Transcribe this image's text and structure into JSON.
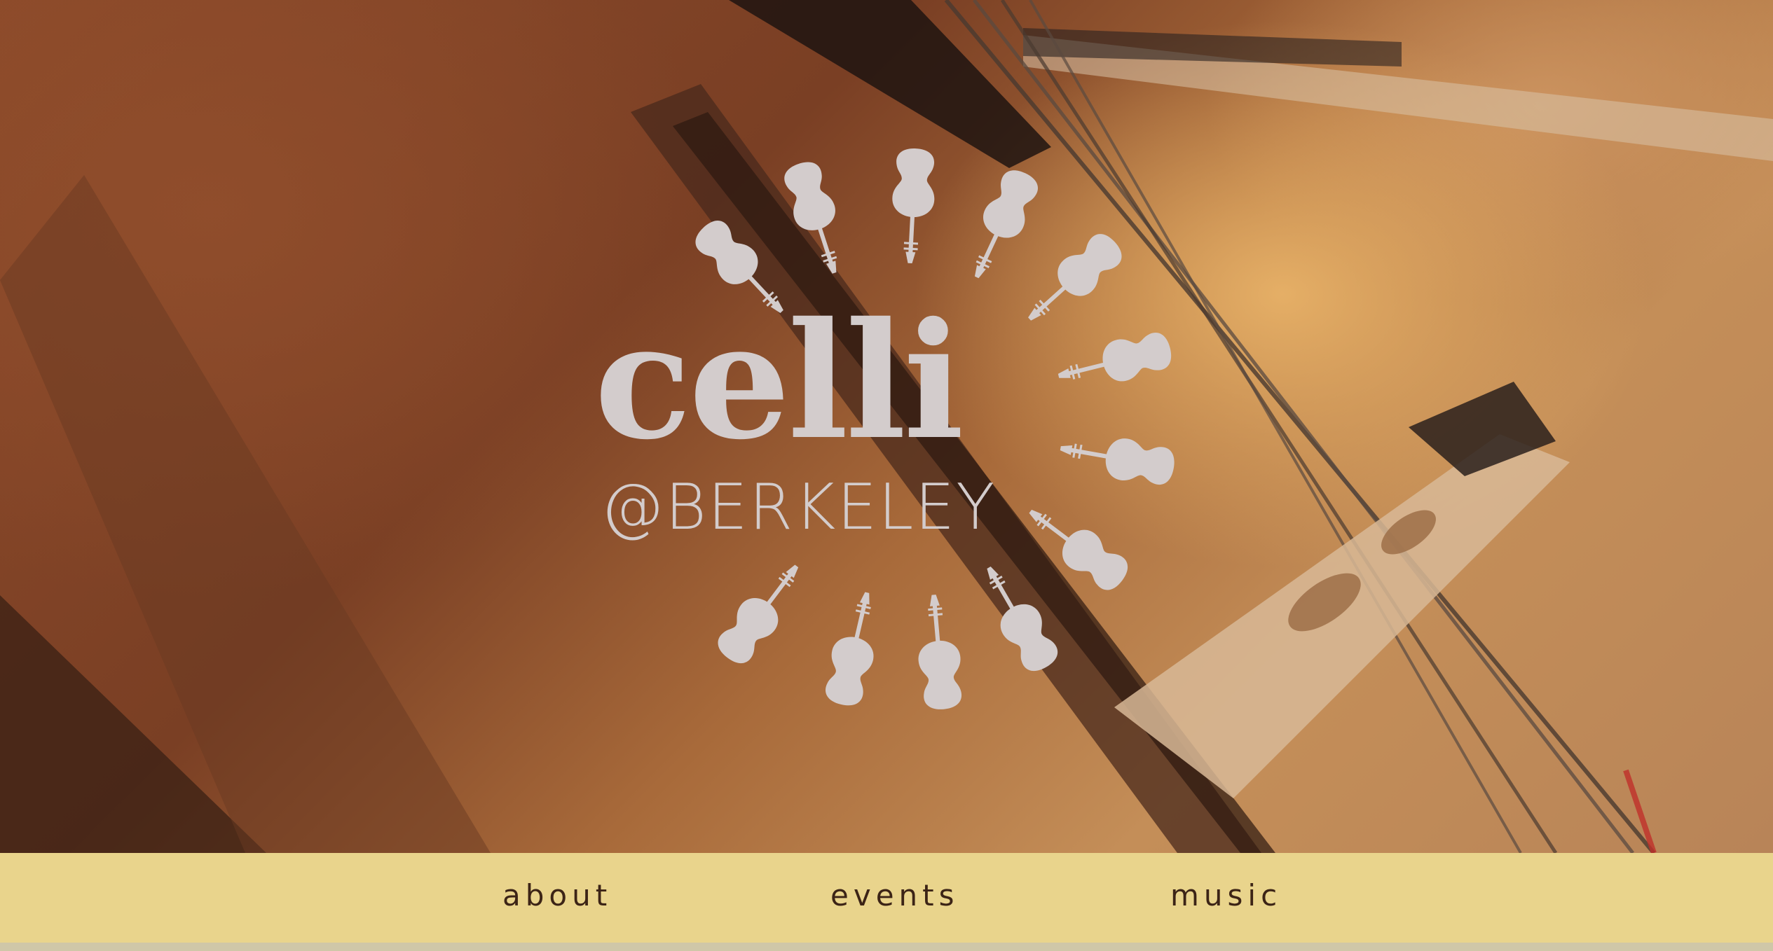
{
  "logo": {
    "title": "celli",
    "subtitle": "@BERKELEY",
    "icon": "cello-ring-icon"
  },
  "nav": {
    "items": [
      {
        "label": "about"
      },
      {
        "label": "events"
      },
      {
        "label": "music"
      }
    ]
  },
  "colors": {
    "nav_background": "#e9d48c",
    "nav_text": "#3c2416",
    "logo": "#d3cccc"
  }
}
